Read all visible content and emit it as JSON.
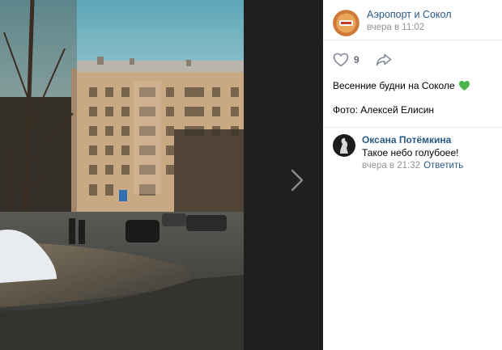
{
  "post": {
    "author": "Аэропорт и Сокол",
    "time": "вчера в 11:02",
    "like_count": "9",
    "text": "Весенние будни на Соколе",
    "photo_credit": "Фото: Алексей Елисин"
  },
  "comment": {
    "author": "Оксана Потёмкина",
    "text": "Такое небо голубоее!",
    "time": "вчера в 21:32",
    "reply_label": "Ответить"
  },
  "icons": {
    "next": "chevron-right-icon",
    "like": "heart-icon",
    "share": "share-arrow-icon",
    "emoji": "green-heart-icon"
  },
  "colors": {
    "link": "#2a5885",
    "muted": "#939393",
    "viewer_bg": "#1f1f1f",
    "emoji_green": "#4bb34b"
  }
}
